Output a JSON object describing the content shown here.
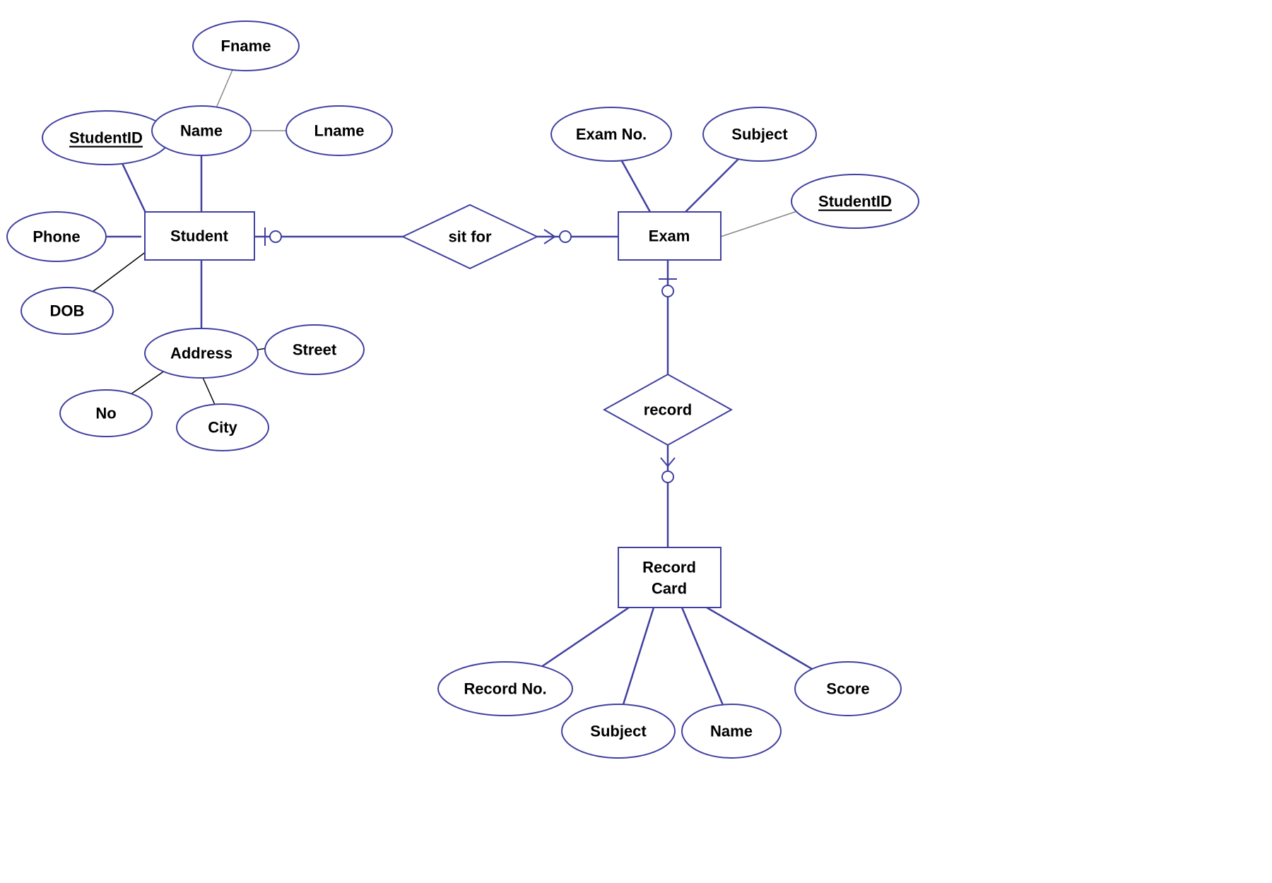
{
  "entities": {
    "student": "Student",
    "exam": "Exam",
    "recordCard": "Record\nCard"
  },
  "relationships": {
    "sitFor": "sit for",
    "record": "record"
  },
  "attributes": {
    "student": {
      "studentId": "StudentID",
      "name": "Name",
      "fname": "Fname",
      "lname": "Lname",
      "phone": "Phone",
      "dob": "DOB",
      "address": "Address",
      "no": "No",
      "city": "City",
      "street": "Street"
    },
    "exam": {
      "examNo": "Exam No.",
      "subject": "Subject",
      "studentId": "StudentID"
    },
    "recordCard": {
      "recordNo": "Record No.",
      "subject": "Subject",
      "name": "Name",
      "score": "Score"
    }
  }
}
